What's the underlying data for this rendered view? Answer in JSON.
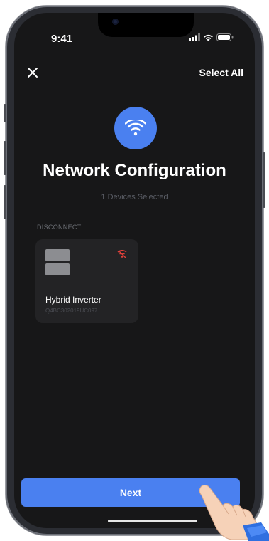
{
  "status_bar": {
    "time": "9:41"
  },
  "header": {
    "close_icon": "close-icon",
    "select_all_label": "Select All"
  },
  "hero": {
    "icon": "wifi-icon",
    "title": "Network Configuration",
    "subtitle": "1 Devices Selected"
  },
  "section": {
    "label": "DISCONNECT"
  },
  "devices": [
    {
      "name": "Hybrid Inverter",
      "serial": "Q4BC302019UC097",
      "status_icon": "wifi-off-icon"
    }
  ],
  "footer": {
    "next_label": "Next"
  },
  "colors": {
    "accent": "#4a80f0",
    "background": "#171718",
    "card": "#232325",
    "danger": "#e0403a"
  }
}
